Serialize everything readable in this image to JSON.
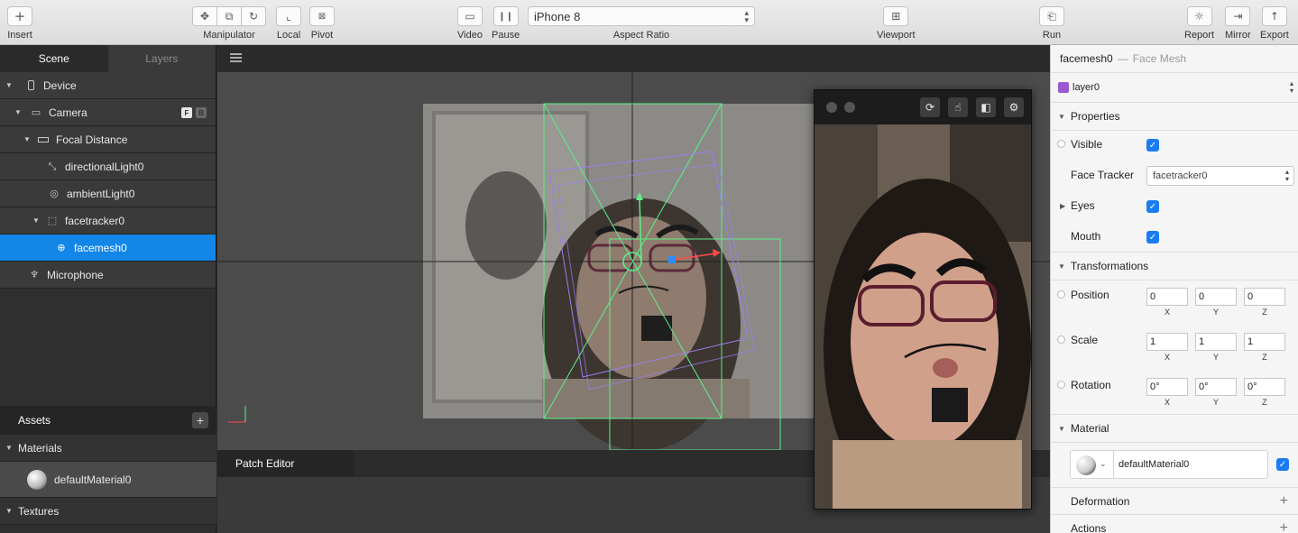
{
  "toolbar": {
    "insert_label": "Insert",
    "manipulator_label": "Manipulator",
    "local_label": "Local",
    "pivot_label": "Pivot",
    "video_label": "Video",
    "pause_label": "Pause",
    "device_value": "iPhone 8",
    "aspect_label": "Aspect Ratio",
    "viewport_label": "Viewport",
    "run_label": "Run",
    "report_label": "Report",
    "mirror_label": "Mirror",
    "export_label": "Export"
  },
  "left": {
    "tabs": [
      "Scene",
      "Layers"
    ],
    "scene": [
      {
        "label": "Device",
        "icon": "phone-icon"
      },
      {
        "label": "Camera",
        "icon": "camera-icon"
      },
      {
        "label": "Focal Distance",
        "icon": "ruler-icon"
      },
      {
        "label": "directionalLight0",
        "icon": "directional-light-icon"
      },
      {
        "label": "ambientLight0",
        "icon": "ambient-light-icon"
      },
      {
        "label": "facetracker0",
        "icon": "face-tracker-icon"
      },
      {
        "label": "facemesh0",
        "icon": "globe-icon"
      },
      {
        "label": "Microphone",
        "icon": "microphone-icon"
      }
    ],
    "camera_badges": [
      "F",
      "B"
    ],
    "assets_label": "Assets",
    "materials_label": "Materials",
    "material_item": "defaultMaterial0",
    "textures_label": "Textures"
  },
  "patch_editor_label": "Patch Editor",
  "inspector": {
    "object_name": "facemesh0",
    "object_type": "Face Mesh",
    "dash": "—",
    "layer_value": "layer0",
    "layer_color": "#9b59d0",
    "properties_label": "Properties",
    "visible_label": "Visible",
    "face_tracker_label": "Face Tracker",
    "face_tracker_value": "facetracker0",
    "eyes_label": "Eyes",
    "mouth_label": "Mouth",
    "transformations_label": "Transformations",
    "position_label": "Position",
    "position": [
      "0",
      "0",
      "0"
    ],
    "scale_label": "Scale",
    "scale": [
      "1",
      "1",
      "1"
    ],
    "rotation_label": "Rotation",
    "rotation": [
      "0°",
      "0°",
      "0°"
    ],
    "axis_labels": [
      "X",
      "Y",
      "Z"
    ],
    "material_label": "Material",
    "material_value": "defaultMaterial0",
    "deformation_label": "Deformation",
    "actions_label": "Actions"
  },
  "colors": {
    "selection": "#1287e8",
    "checkbox": "#1a7cf2",
    "bounds": "#5cf08a",
    "mesh_box": "#9b7ff0"
  }
}
